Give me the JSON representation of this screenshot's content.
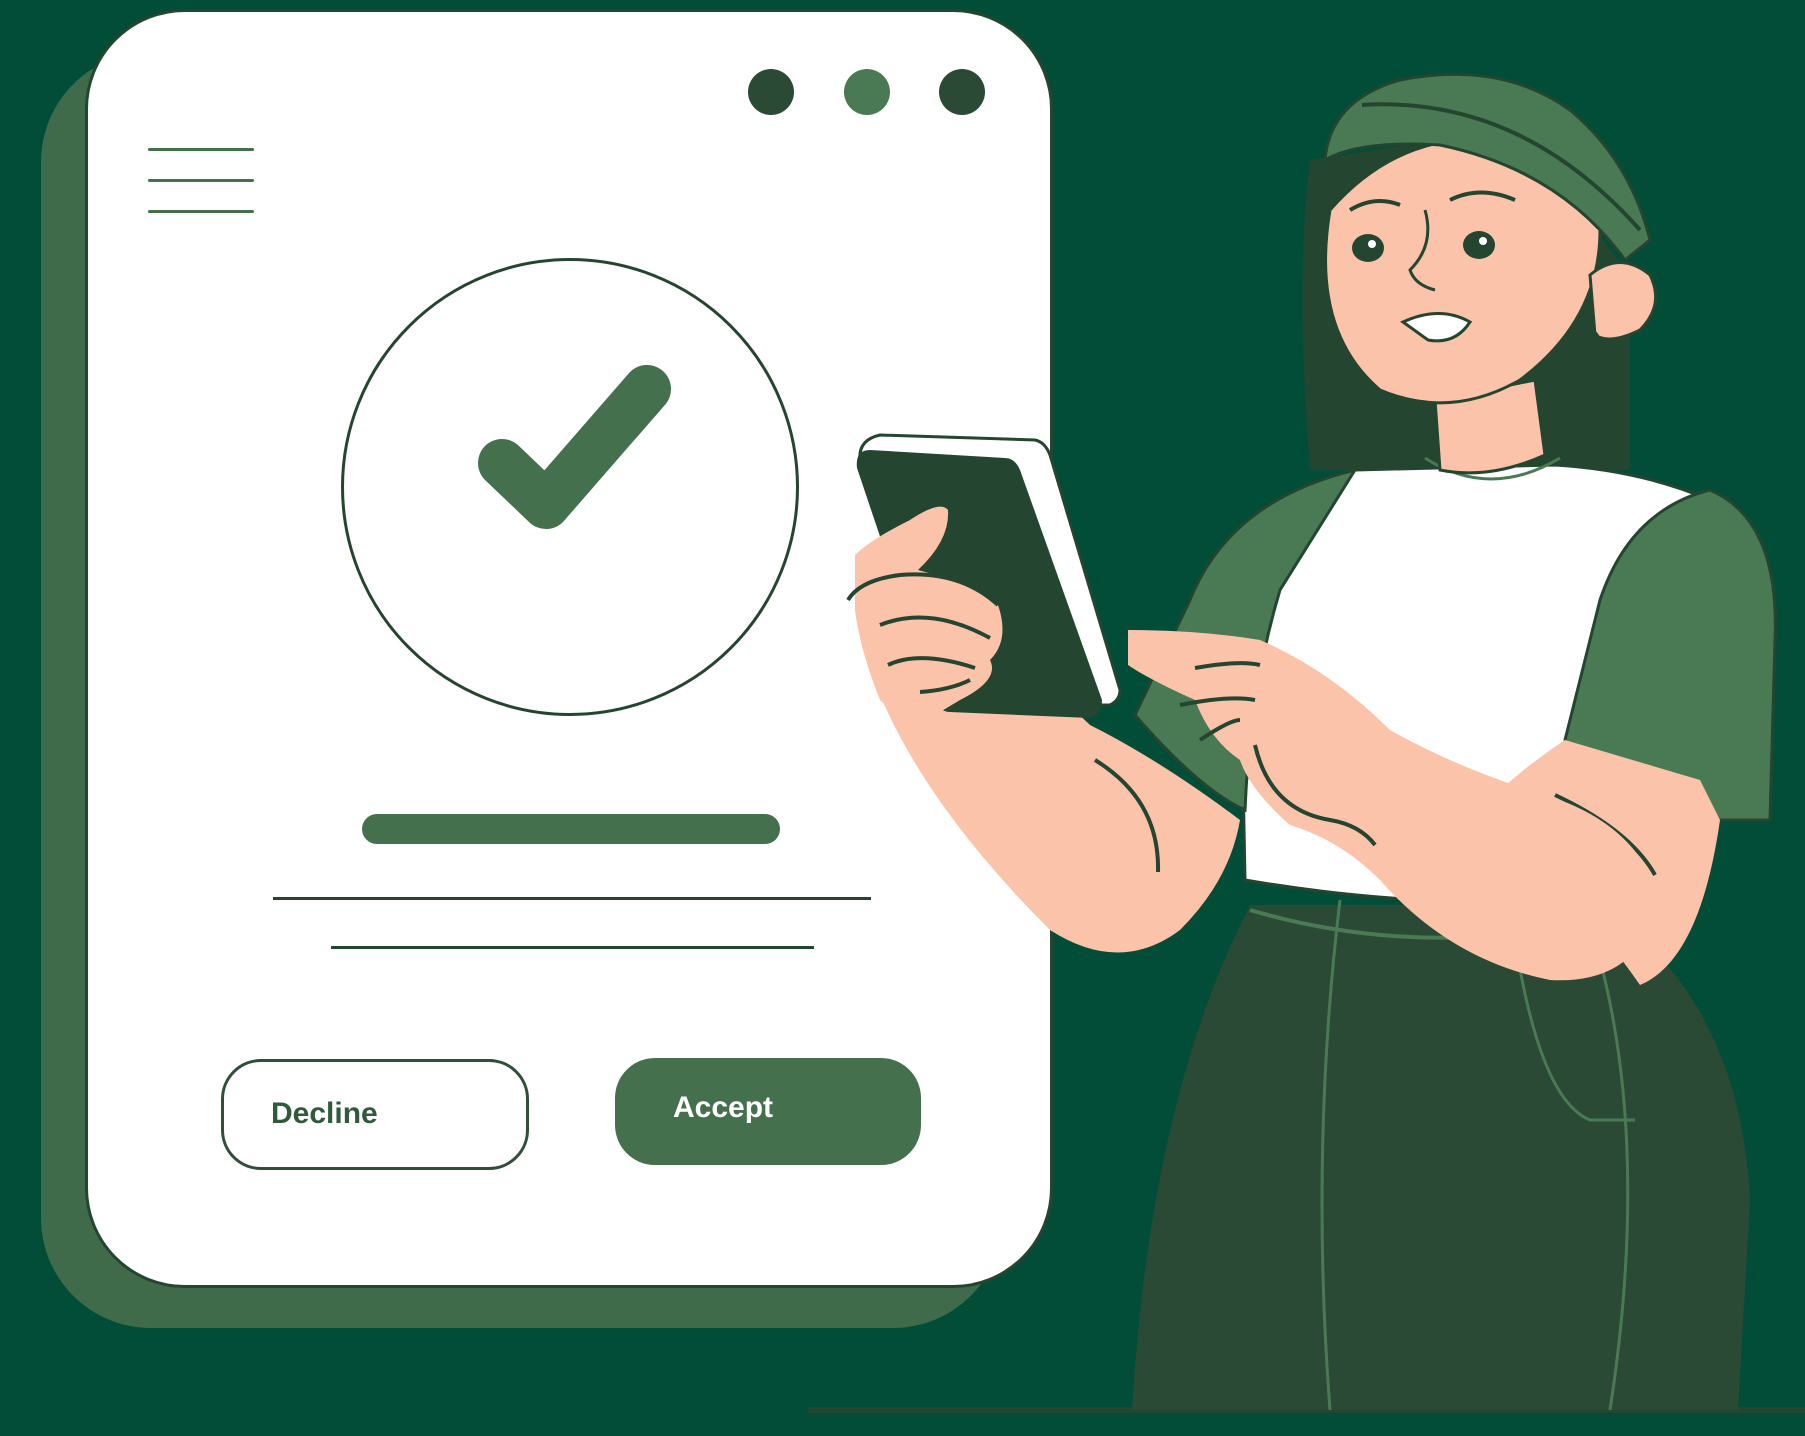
{
  "dialog": {
    "window_controls": [
      "window-dot",
      "window-dot",
      "window-dot"
    ],
    "menu_icon": "hamburger-menu-icon",
    "status_icon": "check-circle-icon",
    "decline_label": "Decline",
    "accept_label": "Accept"
  },
  "colors": {
    "background": "#024d38",
    "card": "#ffffff",
    "accent": "#44704e",
    "dark": "#24452f",
    "skin": "#fcc3ab"
  }
}
